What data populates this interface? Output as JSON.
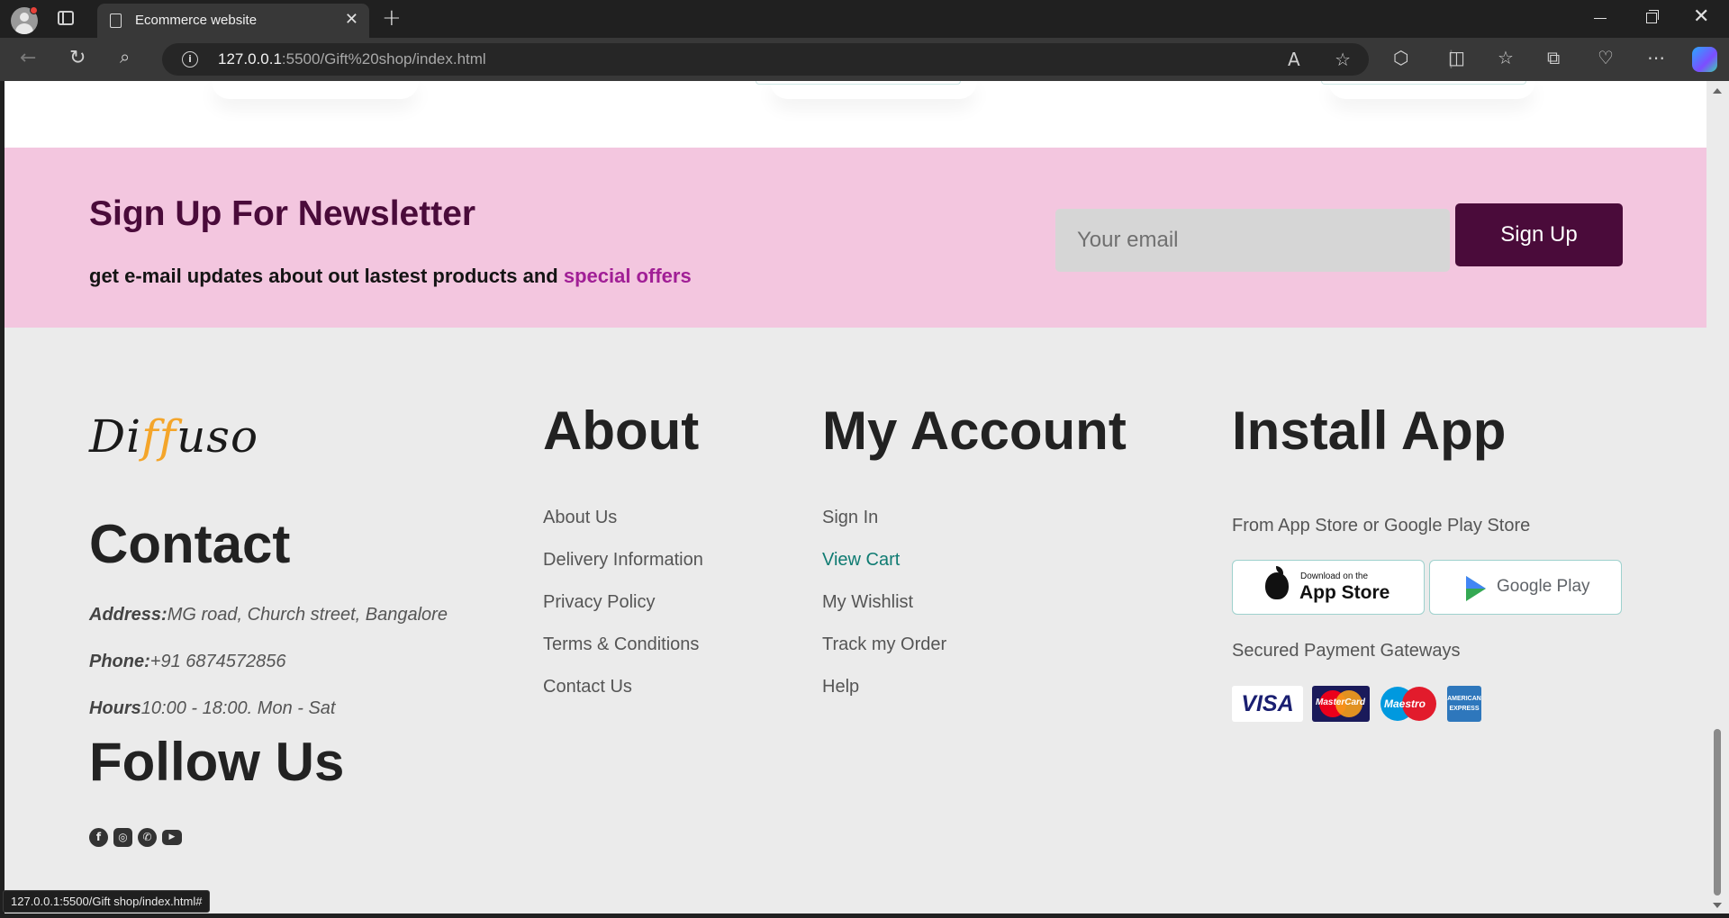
{
  "browser": {
    "tab_title": "Ecommerce website",
    "url_host": "127.0.0.1",
    "url_path": ":5500/Gift%20shop/index.html",
    "status_url": "127.0.0.1:5500/Gift shop/index.html#"
  },
  "newsletter": {
    "title": "Sign Up For Newsletter",
    "subtitle_prefix": "get e-mail updates about out lastest products and ",
    "subtitle_highlight": "special offers",
    "email_placeholder": "Your email",
    "button_label": "Sign Up",
    "colors": {
      "background": "#f3c6df",
      "accent": "#4a0b3a",
      "highlight": "#a11f96"
    }
  },
  "footer": {
    "logo": {
      "pre": "Di",
      "mid": "ff",
      "post": "uso"
    },
    "contact": {
      "heading": "Contact",
      "address_label": "Address:",
      "address": "MG road, Church street, Bangalore",
      "phone_label": "Phone:",
      "phone": "+91 6874572856",
      "hours_label": "Hours",
      "hours": "10:00 - 18:00. Mon - Sat"
    },
    "follow": {
      "heading": "Follow Us",
      "icons": [
        "facebook-icon",
        "instagram-icon",
        "whatsapp-icon",
        "youtube-icon"
      ]
    },
    "about": {
      "heading": "About",
      "links": [
        "About Us",
        "Delivery Information",
        "Privacy Policy",
        "Terms & Conditions",
        "Contact Us"
      ]
    },
    "account": {
      "heading": "My Account",
      "links": [
        "Sign In",
        "View Cart",
        "My Wishlist",
        "Track my Order",
        "Help"
      ]
    },
    "install": {
      "heading": "Install App",
      "from_text": "From App Store or Google Play Store",
      "appstore_small": "Download on the",
      "appstore_big": "App Store",
      "googleplay": "Google Play",
      "payments_text": "Secured Payment Gateways",
      "cards": {
        "visa": "VISA",
        "mastercard": "MasterCard",
        "maestro": "Maestro",
        "amex": "AMERICAN EXPRESS"
      }
    }
  }
}
